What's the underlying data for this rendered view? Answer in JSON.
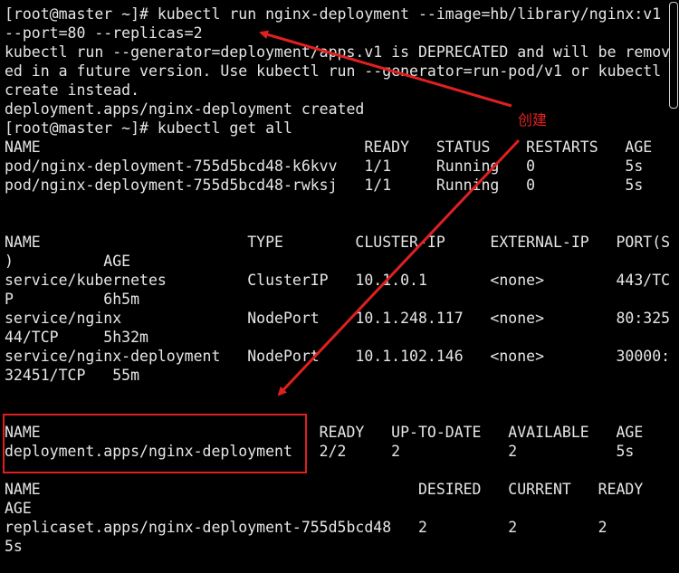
{
  "terminal": {
    "lines": [
      "[root@master ~]# kubectl run nginx-deployment --image=hb/library/nginx:v1",
      "--port=80 --replicas=2",
      "kubectl run --generator=deployment/apps.v1 is DEPRECATED and will be remov",
      "ed in a future version. Use kubectl run --generator=run-pod/v1 or kubectl",
      "create instead.",
      "deployment.apps/nginx-deployment created",
      "[root@master ~]# kubectl get all",
      "NAME                                    READY   STATUS    RESTARTS   AGE",
      "pod/nginx-deployment-755d5bcd48-k6kvv   1/1     Running   0          5s",
      "pod/nginx-deployment-755d5bcd48-rwksj   1/1     Running   0          5s",
      "",
      "",
      "NAME                       TYPE        CLUSTER-IP     EXTERNAL-IP   PORT(S",
      ")          AGE",
      "service/kubernetes         ClusterIP   10.1.0.1       <none>        443/TC",
      "P          6h5m",
      "service/nginx              NodePort    10.1.248.117   <none>        80:325",
      "44/TCP     5h32m",
      "service/nginx-deployment   NodePort    10.1.102.146   <none>        30000:",
      "32451/TCP   55m",
      "",
      "",
      "NAME                               READY   UP-TO-DATE   AVAILABLE   AGE",
      "deployment.apps/nginx-deployment   2/2     2            2           5s",
      "",
      "NAME                                          DESIRED   CURRENT   READY",
      "AGE",
      "replicaset.apps/nginx-deployment-755d5bcd48   2         2         2",
      "5s"
    ]
  },
  "annotation": {
    "label": "创建",
    "color": "#e02020"
  },
  "colors": {
    "background": "#000000",
    "text": "#e6e6e6",
    "annotation": "#e02020"
  }
}
